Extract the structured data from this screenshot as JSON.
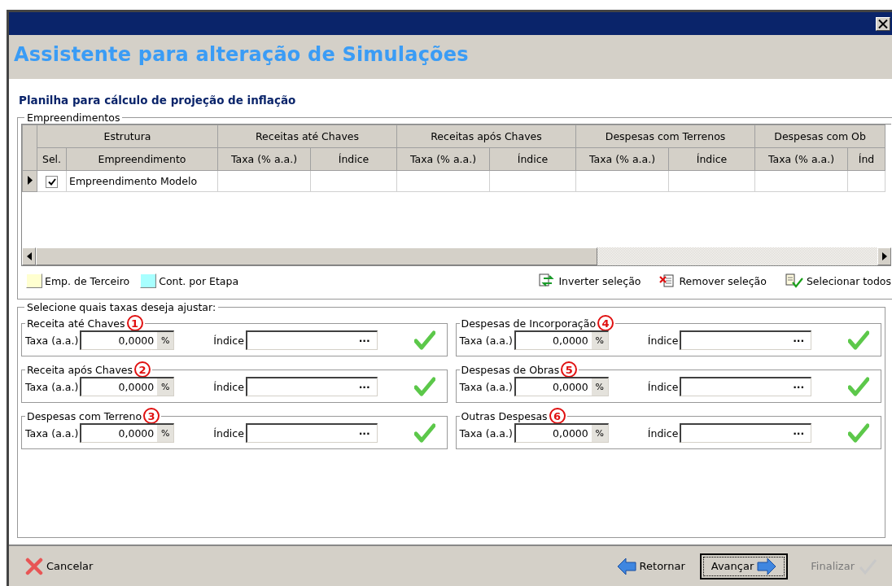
{
  "window": {
    "title": "Assistente para alteração de Simulações"
  },
  "section_title": "Planilha para cálculo de projeção de inflação",
  "empreendimentos": {
    "legend": "Empreendimentos",
    "column_groups": [
      {
        "label": "Estrutura",
        "columns": [
          "Sel.",
          "Empreendimento"
        ]
      },
      {
        "label": "Receitas até Chaves",
        "columns": [
          "Taxa (% a.a.)",
          "Índice"
        ]
      },
      {
        "label": "Receitas após Chaves",
        "columns": [
          "Taxa (% a.a.)",
          "Índice"
        ]
      },
      {
        "label": "Despesas com Terrenos",
        "columns": [
          "Taxa (% a.a.)",
          "Índice"
        ]
      },
      {
        "label": "Despesas com Ob",
        "columns": [
          "Taxa (% a.a.)",
          "Índ"
        ]
      }
    ],
    "rows": [
      {
        "current": true,
        "checked": true,
        "name": "Empreendimento Modelo"
      }
    ],
    "legend_items": [
      {
        "label": "Emp. de Terceiro",
        "color": "#ffffd0"
      },
      {
        "label": "Cont. por Etapa",
        "color": "#a8ffff"
      }
    ],
    "actions": [
      {
        "kind": "invert",
        "label": "Inverter seleção"
      },
      {
        "kind": "remove",
        "label": "Remover seleção"
      },
      {
        "kind": "select_all",
        "label": "Selecionar todos"
      }
    ]
  },
  "taxas": {
    "legend": "Selecione quais taxas deseja ajustar:",
    "groups": [
      {
        "title": "Receita até Chaves",
        "badge": "1",
        "taxa_label": "Taxa (a.a.)",
        "taxa_value": "0,0000",
        "unit": "%",
        "indice_label": "Índice",
        "browse": "...",
        "confirmed": true
      },
      {
        "title": "Receita após Chaves",
        "badge": "2",
        "taxa_label": "Taxa (a.a.)",
        "taxa_value": "0,0000",
        "unit": "%",
        "indice_label": "Índice",
        "browse": "...",
        "confirmed": true
      },
      {
        "title": "Despesas com Terreno",
        "badge": "3",
        "taxa_label": "Taxa (a.a.)",
        "taxa_value": "0,0000",
        "unit": "%",
        "indice_label": "Índice",
        "browse": "...",
        "confirmed": true
      },
      {
        "title": "Despesas de Incorporação",
        "badge": "4",
        "taxa_label": "Taxa (a.a.)",
        "taxa_value": "0,0000",
        "unit": "%",
        "indice_label": "Índice",
        "browse": "...",
        "confirmed": true
      },
      {
        "title": "Despesas de Obras",
        "badge": "5",
        "taxa_label": "Taxa (a.a.)",
        "taxa_value": "0,0000",
        "unit": "%",
        "indice_label": "Índice",
        "browse": "...",
        "confirmed": true
      },
      {
        "title": "Outras Despesas",
        "badge": "6",
        "taxa_label": "Taxa (a.a.)",
        "taxa_value": "0,0000",
        "unit": "%",
        "indice_label": "Índice",
        "browse": "...",
        "confirmed": true
      }
    ]
  },
  "buttons": [
    {
      "kind": "cancel",
      "label": "Cancelar",
      "disabled": false,
      "default": false
    },
    {
      "kind": "back",
      "label": "Retornar",
      "disabled": false,
      "default": false
    },
    {
      "kind": "next",
      "label": "Avançar",
      "disabled": false,
      "default": true
    },
    {
      "kind": "finish",
      "label": "Finalizar",
      "disabled": true,
      "default": false
    }
  ]
}
